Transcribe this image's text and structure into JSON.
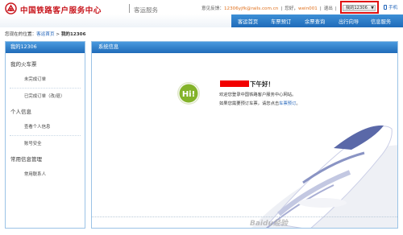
{
  "header": {
    "brand": "中国铁路客户服务中心",
    "sub_brand": "客运服务",
    "feedback_label": "意见反馈：",
    "feedback_email": "12306yjfk@rails.com.cn",
    "greeting_label": "您好，",
    "username": "wein001",
    "separator": "|",
    "logout": "退出",
    "my_account": "我的12306",
    "mobile": "手机"
  },
  "nav": {
    "items": [
      "客运首页",
      "车票预订",
      "余票查询",
      "出行向导",
      "信息服务"
    ]
  },
  "breadcrumb": {
    "prefix": "您现在的位置：",
    "home": "客运首页",
    "arrow": ">",
    "current": "我的12306"
  },
  "sidebar": {
    "title": "我的12306",
    "group_tickets": "我的火车票",
    "item_unfinished": "未完成订单",
    "item_finished": "已完成订单（改/退）",
    "group_personal": "个人信息",
    "item_view_info": "查看个人信息",
    "item_security": "账号安全",
    "group_contacts": "常用信息管理",
    "item_contacts": "常用联系人"
  },
  "main": {
    "title": "系统信息",
    "greeting": "下午好！",
    "welcome": "欢迎您登录中国铁路客户服务中心网站。",
    "hint_prefix": "如果您需要预订车票，请您点击",
    "hint_link": "车票预订",
    "hint_suffix": "。",
    "badge": "Hi!"
  },
  "watermark": "Baidu经验",
  "colors": {
    "brand_red": "#c8161d",
    "nav_blue": "#1f6bb9",
    "link_blue": "#1d61b8",
    "highlight": "#e01010"
  }
}
